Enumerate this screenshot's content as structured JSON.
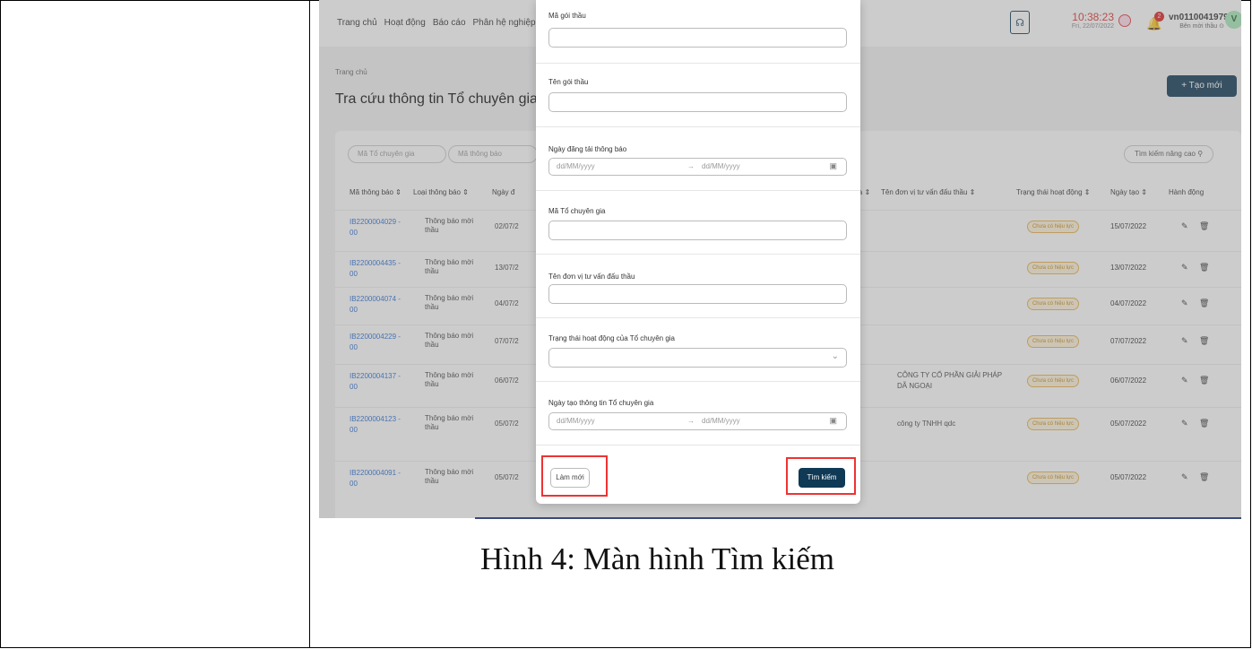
{
  "topbar": {
    "nav": [
      "Trang chủ",
      "Hoạt động",
      "Báo cáo",
      "Phân hệ nghiệp"
    ],
    "support_icon": "headset-icon",
    "time": "10:38:23",
    "date": "Fri, 22/07/2022",
    "notification_count": "2",
    "username": "vn0110041979",
    "user_role": "Bên mời thầu ⊙",
    "avatar_letter": "V"
  },
  "page": {
    "breadcrumb": "Trang chủ",
    "title": "Tra cứu thông tin Tổ chuyên gia",
    "create_button": "+ Tạo mới"
  },
  "filters": {
    "expert_code_placeholder": "Mã Tổ chuyên gia",
    "notice_code_placeholder": "Mã thông báo",
    "advanced_search": "Tìm kiếm nâng cao ⚲"
  },
  "table": {
    "headers": {
      "code": "Mã thông báo ⇕",
      "type": "Loại thông báo ⇕",
      "post_date": "Ngày đ",
      "expert": "ia ⇕",
      "consultant": "Tên đơn vị tư vấn đấu thầu ⇕",
      "status": "Trạng thái hoạt động ⇕",
      "created": "Ngày tạo ⇕",
      "actions": "Hành động"
    },
    "rows": [
      {
        "code1": "IB2200004029 -",
        "code2": "00",
        "type1": "Thông báo mời",
        "type2": "thầu",
        "post": "02/07/2",
        "consultant1": "",
        "consultant2": "",
        "status": "Chưa có hiệu lực",
        "created": "15/07/2022"
      },
      {
        "code1": "IB2200004435 -",
        "code2": "00",
        "type1": "Thông báo mời",
        "type2": "thầu",
        "post": "13/07/2",
        "consultant1": "",
        "consultant2": "",
        "status": "Chưa có hiệu lực",
        "created": "13/07/2022"
      },
      {
        "code1": "IB2200004074 -",
        "code2": "00",
        "type1": "Thông báo mời",
        "type2": "thầu",
        "post": "04/07/2",
        "consultant1": "",
        "consultant2": "",
        "status": "Chưa có hiệu lực",
        "created": "04/07/2022"
      },
      {
        "code1": "IB2200004229 -",
        "code2": "00",
        "type1": "Thông báo mời",
        "type2": "thầu",
        "post": "07/07/2",
        "consultant1": "",
        "consultant2": "",
        "status": "Chưa có hiệu lực",
        "created": "07/07/2022"
      },
      {
        "code1": "IB2200004137 -",
        "code2": "00",
        "type1": "Thông báo mời",
        "type2": "thầu",
        "post": "06/07/2",
        "consultant1": "CÔNG TY CỔ PHẦN GIẢI PHÁP",
        "consultant2": "DÃ NGOẠI",
        "status": "Chưa có hiệu lực",
        "created": "06/07/2022"
      },
      {
        "code1": "IB2200004123 -",
        "code2": "00",
        "type1": "Thông báo mời",
        "type2": "thầu",
        "post": "05/07/2",
        "consultant1": "công ty TNHH qdc",
        "consultant2": "",
        "status": "Chưa có hiệu lực",
        "created": "05/07/2022"
      },
      {
        "code1": "IB2200004091 -",
        "code2": "00",
        "type1": "Thông báo mời",
        "type2": "thầu",
        "post": "05/07/2",
        "consultant1": "",
        "consultant2": "",
        "status": "Chưa có hiệu lực",
        "created": "05/07/2022"
      }
    ]
  },
  "modal": {
    "package_code_label": "Mã gói thầu",
    "package_name_label": "Tên gói thầu",
    "post_date_label": "Ngày đăng tải thông báo",
    "date_placeholder": "dd/MM/yyyy",
    "expert_code_label": "Mã Tổ chuyên gia",
    "consultant_label": "Tên đơn vị tư vấn đấu thầu",
    "status_label": "Trạng thái hoạt động của Tổ chuyên gia",
    "created_date_label": "Ngày tạo thông tin Tổ chuyên gia",
    "reset_button": "Làm mới",
    "search_button": "Tìm kiếm"
  },
  "caption": "Hình 4: Màn hình Tìm kiếm",
  "colors": {
    "primary": "#0f3955",
    "link": "#2a6fd6",
    "highlight": "#e33333",
    "badge": "#e9b44c"
  }
}
